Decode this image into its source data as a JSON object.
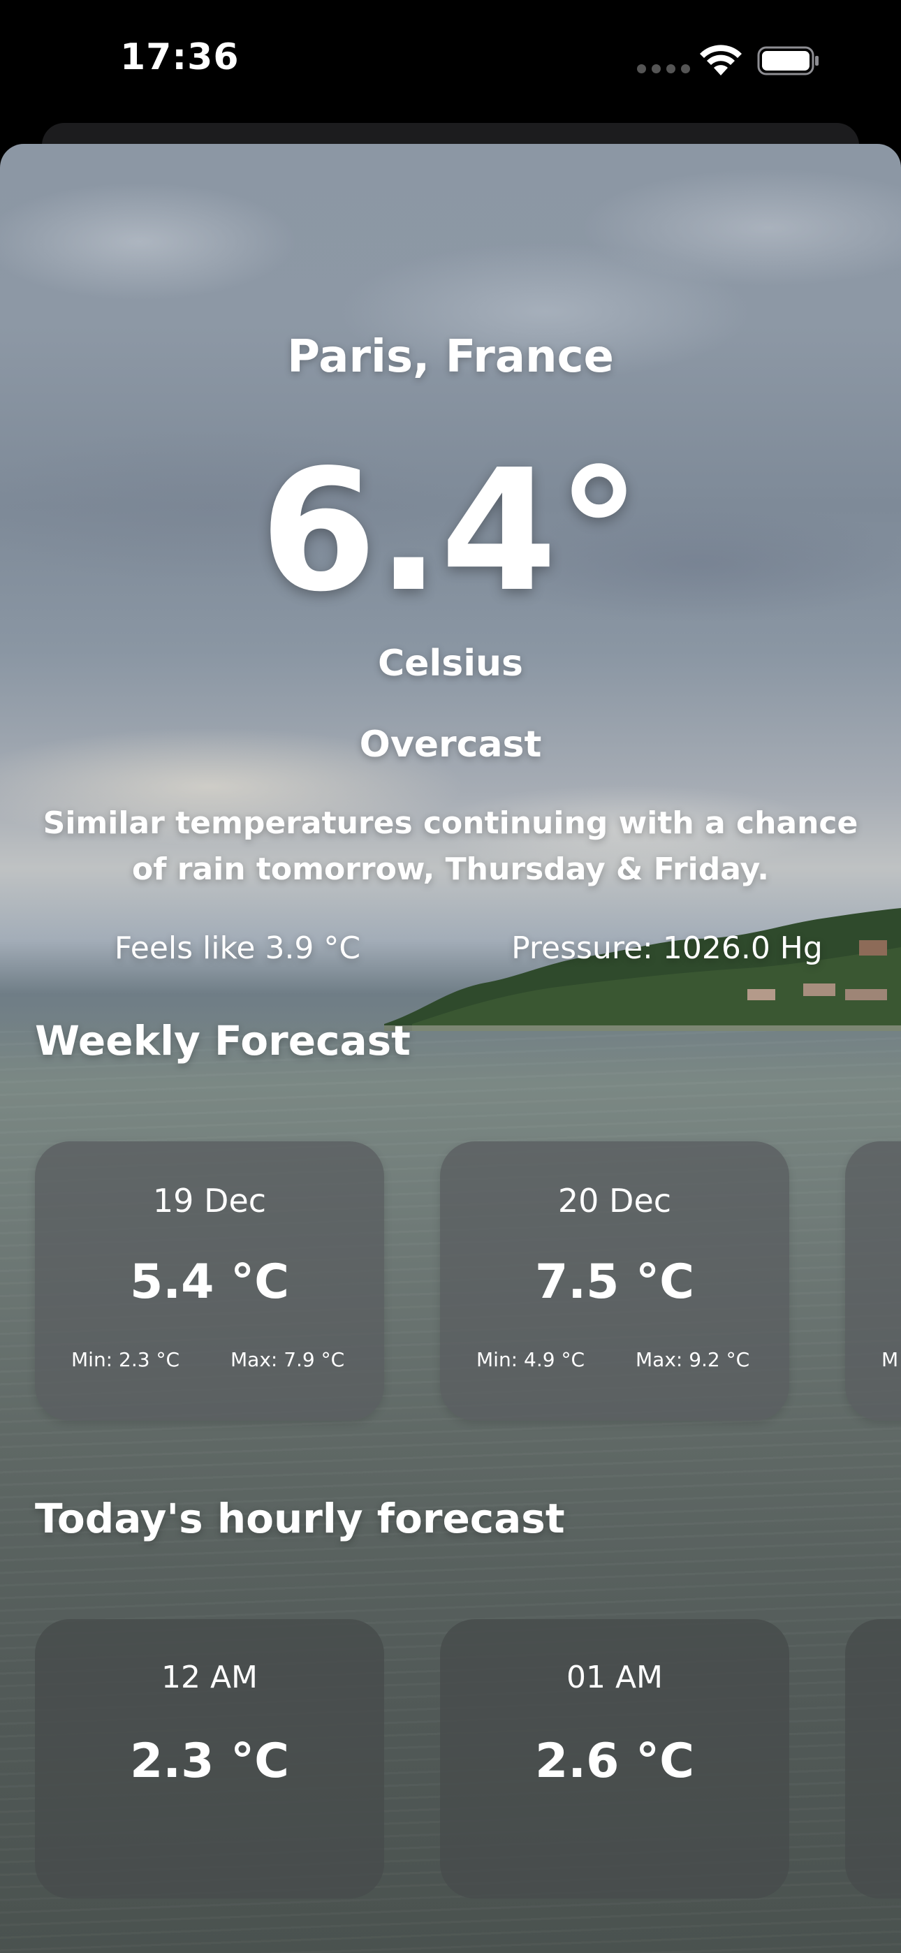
{
  "status_bar": {
    "time": "17:36"
  },
  "weather": {
    "location": "Paris, France",
    "temperature": "6.4°",
    "unit": "Celsius",
    "condition": "Overcast",
    "description": "Similar temperatures continuing with a chance of rain tomorrow, Thursday & Friday.",
    "feels_like": "Feels like 3.9 °C",
    "pressure": "Pressure: 1026.0 Hg"
  },
  "weekly": {
    "title": "Weekly Forecast",
    "days": [
      {
        "date": "19 Dec",
        "temp": "5.4 °C",
        "min": "Min:  2.3 °C",
        "max": "Max:  7.9 °C"
      },
      {
        "date": "20 Dec",
        "temp": "7.5 °C",
        "min": "Min:  4.9 °C",
        "max": "Max:  9.2 °C"
      },
      {
        "date": "",
        "temp": "",
        "min": "M",
        "max": ""
      }
    ]
  },
  "hourly": {
    "title": "Today's hourly forecast",
    "hours": [
      {
        "hour": "12 AM",
        "temp": "2.3 °C"
      },
      {
        "hour": "01 AM",
        "temp": "2.6 °C"
      },
      {
        "hour": "",
        "temp": ""
      }
    ]
  },
  "icons": {
    "wifi": "wifi-icon",
    "battery": "battery-icon",
    "signal": "cellular-signal-icon"
  },
  "colors": {
    "card_background": "#5a5e60",
    "text": "#ffffff"
  }
}
